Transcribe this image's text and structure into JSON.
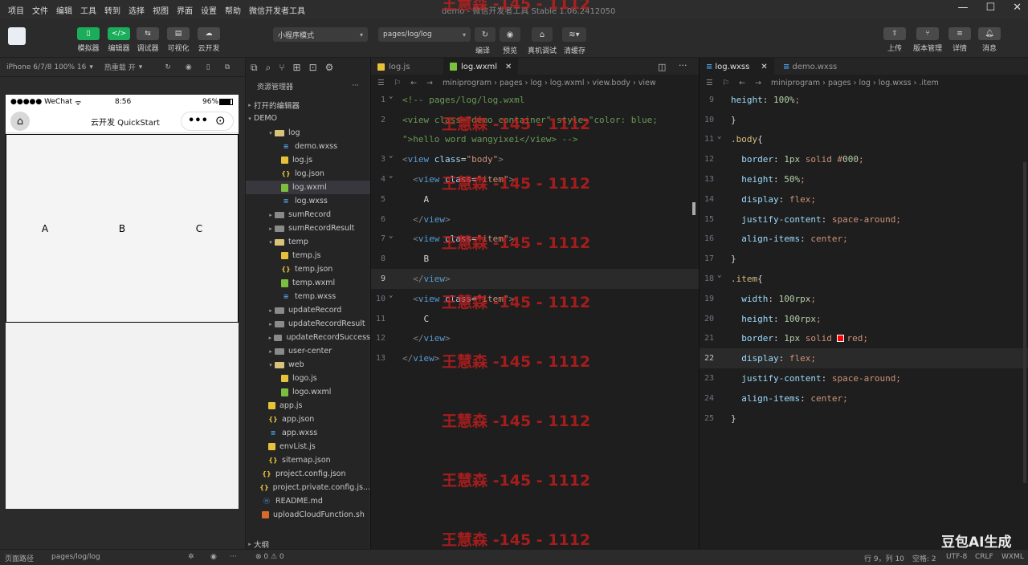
{
  "menu": [
    "项目",
    "文件",
    "编辑",
    "工具",
    "转到",
    "选择",
    "视图",
    "界面",
    "设置",
    "帮助",
    "微信开发者工具"
  ],
  "window_title": "demo - 微信开发者工具 Stable 1.06.2412050",
  "toolbar": {
    "buttons": [
      "模拟器",
      "编辑器",
      "调试器",
      "可视化",
      "云开发"
    ],
    "mode_select": "小程序模式",
    "page_select": "pages/log/log",
    "mid_buttons": [
      "编译",
      "预览",
      "真机调试",
      "清缓存"
    ],
    "right_buttons": [
      "上传",
      "版本管理",
      "详情",
      "消息"
    ]
  },
  "sim_bar": {
    "device": "iPhone 6/7/8 100% 16",
    "hotreload": "热重载 开"
  },
  "phone": {
    "carrier": "●●●●● WeChat",
    "time": "8:56",
    "battery": "96%",
    "nav_title": "云开发 QuickStart",
    "items": [
      "A",
      "B",
      "C"
    ]
  },
  "explorer": {
    "title": "资源管理器",
    "open_editors": "打开的编辑器",
    "project": "DEMO",
    "tree": [
      {
        "name": "log",
        "type": "folder-open",
        "indent": 2,
        "twisty": "▾"
      },
      {
        "name": "demo.wxss",
        "type": "wxss",
        "indent": 3
      },
      {
        "name": "log.js",
        "type": "js",
        "indent": 3
      },
      {
        "name": "log.json",
        "type": "json",
        "indent": 3
      },
      {
        "name": "log.wxml",
        "type": "wxml",
        "indent": 3,
        "selected": true
      },
      {
        "name": "log.wxss",
        "type": "wxss",
        "indent": 3
      },
      {
        "name": "sumRecord",
        "type": "folder",
        "indent": 2,
        "twisty": "▸"
      },
      {
        "name": "sumRecordResult",
        "type": "folder",
        "indent": 2,
        "twisty": "▸"
      },
      {
        "name": "temp",
        "type": "folder-open",
        "indent": 2,
        "twisty": "▾"
      },
      {
        "name": "temp.js",
        "type": "js",
        "indent": 3
      },
      {
        "name": "temp.json",
        "type": "json",
        "indent": 3
      },
      {
        "name": "temp.wxml",
        "type": "wxml",
        "indent": 3
      },
      {
        "name": "temp.wxss",
        "type": "wxss",
        "indent": 3
      },
      {
        "name": "updateRecord",
        "type": "folder",
        "indent": 2,
        "twisty": "▸"
      },
      {
        "name": "updateRecordResult",
        "type": "folder",
        "indent": 2,
        "twisty": "▸"
      },
      {
        "name": "updateRecordSuccess",
        "type": "folder",
        "indent": 2,
        "twisty": "▸"
      },
      {
        "name": "user-center",
        "type": "folder",
        "indent": 2,
        "twisty": "▸"
      },
      {
        "name": "web",
        "type": "folder-open",
        "indent": 2,
        "twisty": "▾"
      },
      {
        "name": "logo.js",
        "type": "js",
        "indent": 3
      },
      {
        "name": "logo.wxml",
        "type": "wxml",
        "indent": 3
      },
      {
        "name": "app.js",
        "type": "js",
        "indent": 1
      },
      {
        "name": "app.json",
        "type": "json",
        "indent": 1
      },
      {
        "name": "app.wxss",
        "type": "wxss",
        "indent": 1
      },
      {
        "name": "envList.js",
        "type": "js",
        "indent": 1
      },
      {
        "name": "sitemap.json",
        "type": "json",
        "indent": 1
      },
      {
        "name": "project.config.json",
        "type": "json",
        "indent": 0
      },
      {
        "name": "project.private.config.js...",
        "type": "json",
        "indent": 0
      },
      {
        "name": "README.md",
        "type": "md",
        "indent": 0
      },
      {
        "name": "uploadCloudFunction.sh",
        "type": "sh",
        "indent": 0
      }
    ],
    "outline": "大纲"
  },
  "editor1": {
    "tabs": [
      "log.js",
      "log.wxml"
    ],
    "breadcrumb": "miniprogram › pages › log › log.wxml › view.body › view",
    "lines": [
      {
        "n": "1",
        "t": "<!-- pages/log/log.wxml"
      },
      {
        "n": "2",
        "t": "<view class=\"demo container\" style=\"color: blue;"
      },
      {
        "n": "",
        "t": "\">hello word wangyixei</view> -->"
      },
      {
        "n": "3",
        "t": "<view class=\"body\">"
      },
      {
        "n": "4",
        "t": "  <view class=\"item\">"
      },
      {
        "n": "5",
        "t": "    A"
      },
      {
        "n": "6",
        "t": "  </view>"
      },
      {
        "n": "7",
        "t": "  <view class=\"item\">"
      },
      {
        "n": "8",
        "t": "    B"
      },
      {
        "n": "9",
        "t": "  </view>"
      },
      {
        "n": "10",
        "t": "  <view class=\"item\">"
      },
      {
        "n": "11",
        "t": "    C"
      },
      {
        "n": "12",
        "t": "  </view>"
      },
      {
        "n": "13",
        "t": "</view>"
      }
    ]
  },
  "editor2": {
    "tabs": [
      "log.wxss",
      "demo.wxss"
    ],
    "breadcrumb": "miniprogram › pages › log › log.wxss › .item",
    "lines": [
      {
        "n": "9",
        "t": "height: 100%;"
      },
      {
        "n": "10",
        "t": "}"
      },
      {
        "n": "11",
        "t": ".body{"
      },
      {
        "n": "12",
        "t": "  border: 1px solid #000;"
      },
      {
        "n": "13",
        "t": "  height: 50%;"
      },
      {
        "n": "14",
        "t": "  display: flex;"
      },
      {
        "n": "15",
        "t": "  justify-content: space-around;"
      },
      {
        "n": "16",
        "t": "  align-items: center;"
      },
      {
        "n": "17",
        "t": "}"
      },
      {
        "n": "18",
        "t": ".item{"
      },
      {
        "n": "19",
        "t": "  width: 100rpx;"
      },
      {
        "n": "20",
        "t": "  height: 100rpx;"
      },
      {
        "n": "21",
        "t": "  border: 1px solid red;"
      },
      {
        "n": "22",
        "t": "  display: flex;"
      },
      {
        "n": "23",
        "t": "  justify-content: space-around;"
      },
      {
        "n": "24",
        "t": "  align-items: center;"
      },
      {
        "n": "25",
        "t": "}"
      }
    ]
  },
  "status": {
    "page_path_label": "页面路径",
    "page_path": "pages/log/log",
    "problems": "⊗ 0 ⚠ 0",
    "position": "行 9，列 10",
    "spaces": "空格: 2",
    "encoding": "UTF-8",
    "eol": "CRLF",
    "lang": "WXML"
  },
  "watermark": "王慧森 -145 - 1112",
  "brand": "豆包AI生成",
  "colors": {
    "green": "#1aad5a",
    "editor_bg": "#1e1e1e",
    "tag": "#569cd6",
    "attr": "#9cdcfe",
    "string": "#ce9178",
    "comment": "#6a9955",
    "selector": "#d7ba7d",
    "number": "#b5cea8"
  }
}
